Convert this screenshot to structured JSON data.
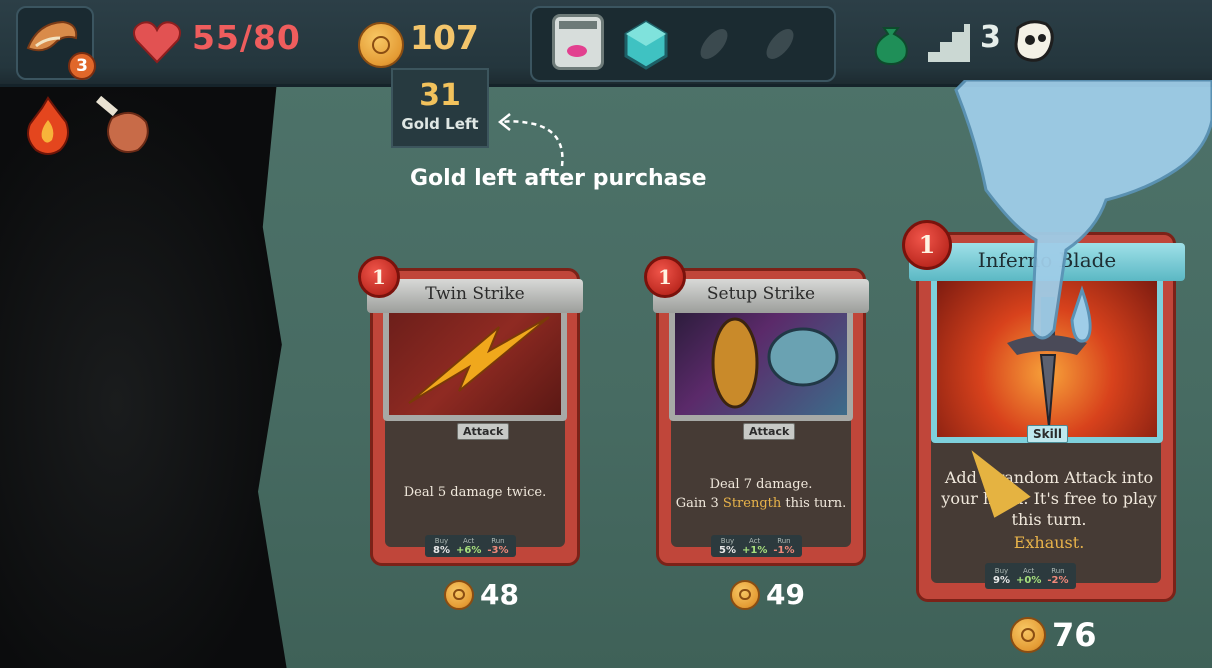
{
  "player": {
    "hp": "55/80",
    "gold": "107",
    "ascension": "3",
    "floor": "3"
  },
  "tooltip": {
    "gold_left_value": "31",
    "gold_left_label": "Gold Left"
  },
  "hint": "Gold left after purchase",
  "cards": [
    {
      "name": "Twin Strike",
      "cost": "1",
      "type": "Attack",
      "description": "Deal 5 damage twice.",
      "stats": {
        "buy_label": "Buy",
        "buy": "8%",
        "act_label": "Act",
        "act": "+6%",
        "run_label": "Run",
        "run": "-3%"
      },
      "price": "48"
    },
    {
      "name": "Setup Strike",
      "cost": "1",
      "type": "Attack",
      "description_line1": "Deal 7 damage.",
      "description_line2_pre": "Gain 3 ",
      "description_line2_kw": "Strength",
      "description_line2_post": " this turn.",
      "stats": {
        "buy_label": "Buy",
        "buy": "5%",
        "act_label": "Act",
        "act": "+1%",
        "run_label": "Run",
        "run": "-1%"
      },
      "price": "49"
    },
    {
      "name": "Inferno Blade",
      "cost": "1",
      "type": "Skill",
      "description_pre": "Add a random Attack into your hand. It's free to play this turn.",
      "description_kw": "Exhaust.",
      "stats": {
        "buy_label": "Buy",
        "buy": "9%",
        "act_label": "Act",
        "act": "+0%",
        "run_label": "Run",
        "run": "-2%"
      },
      "price": "76"
    }
  ],
  "colors": {
    "hp": "#ef5d5d",
    "gold": "#f3c56b",
    "card_frame": "#c0463a",
    "keyword": "#e8b34a"
  }
}
